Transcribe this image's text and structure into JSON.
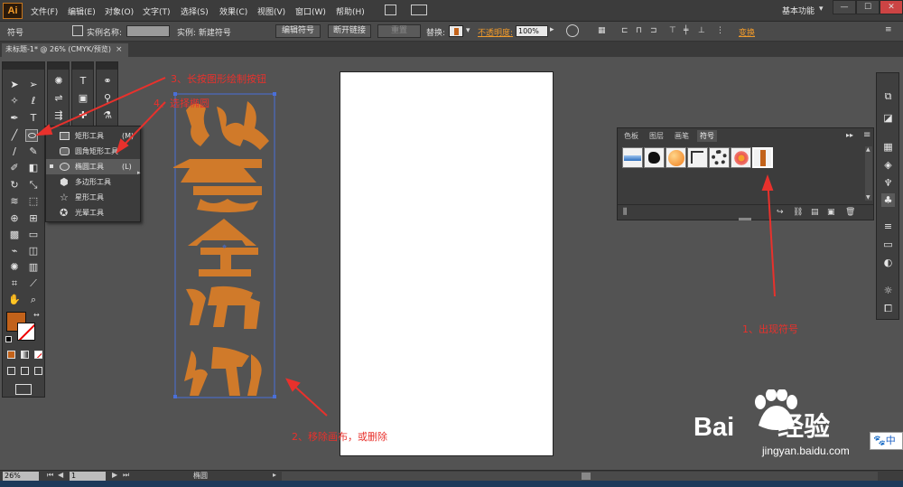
{
  "app": {
    "logo": "Ai",
    "workspace": "基本功能"
  },
  "menu": [
    "文件(F)",
    "编辑(E)",
    "对象(O)",
    "文字(T)",
    "选择(S)",
    "效果(C)",
    "视图(V)",
    "窗口(W)",
    "帮助(H)"
  ],
  "window_buttons": [
    "—",
    "☐",
    "✕"
  ],
  "control_bar": {
    "selection_type": "符号",
    "instance_name_label": "实例名称:",
    "instance_label": "实例: 新建符号",
    "edit_symbol": "编辑符号",
    "break_link": "断开链接",
    "reset": "重置",
    "replace_label": "替换:",
    "opacity_label": "不透明度:",
    "opacity_value": "100%",
    "transform": "变换"
  },
  "document_tab": {
    "title": "未标题-1* @ 26% (CMYK/预览)",
    "close": "×"
  },
  "flyout": {
    "items": [
      {
        "label": "矩形工具",
        "shortcut": "(M)",
        "selected": false
      },
      {
        "label": "圆角矩形工具",
        "shortcut": "",
        "selected": false
      },
      {
        "label": "椭圆工具",
        "shortcut": "(L)",
        "selected": true
      },
      {
        "label": "多边形工具",
        "shortcut": "",
        "selected": false
      },
      {
        "label": "星形工具",
        "shortcut": "",
        "selected": false
      },
      {
        "label": "光晕工具",
        "shortcut": "",
        "selected": false
      }
    ]
  },
  "symbols_panel": {
    "tabs": [
      "色板",
      "图层",
      "画笔",
      "符号"
    ],
    "active_tab": "符号",
    "symbols": [
      "blue-banner-symbol",
      "ink-splat-symbol",
      "orange-sphere-symbol",
      "corner-symbol",
      "wreath-symbol",
      "flower-symbol",
      "new-symbol"
    ]
  },
  "colors": {
    "fill": "#c2621a",
    "accent": "#f29b2a",
    "artwork": "#d07a2a",
    "annotation": "#e8312c"
  },
  "annotations": {
    "a1": "1、出现符号",
    "a2": "2、移除画布，或删除",
    "a3": "3、长按图形绘制按钮",
    "a4": "4、选择椭圆"
  },
  "status_bar": {
    "zoom": "26%",
    "page": "1",
    "tool_name": "椭圆"
  },
  "watermark": {
    "brand": "Bai",
    "brand2": "经验",
    "url": "jingyan.baidu.com",
    "ime": "中"
  }
}
